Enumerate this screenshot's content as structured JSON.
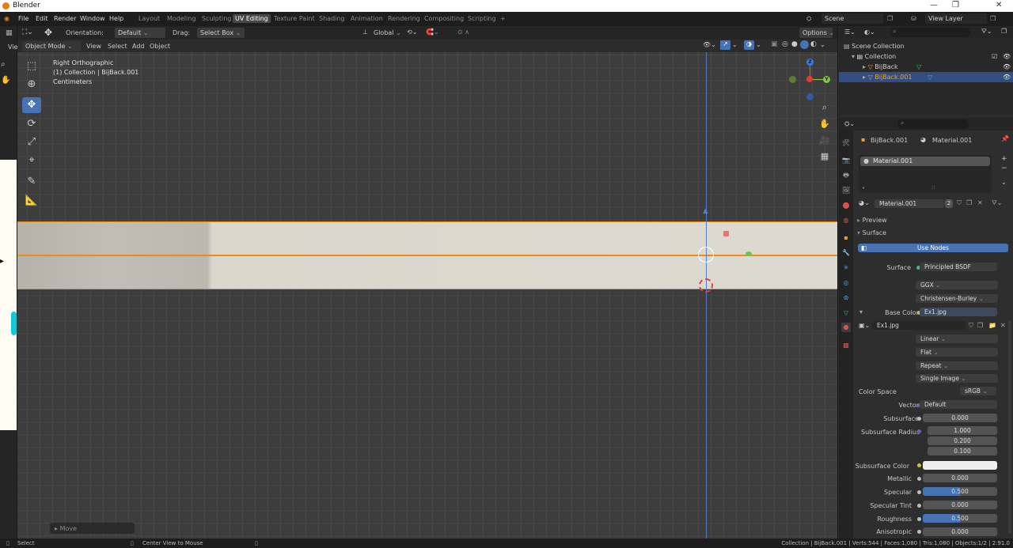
{
  "window": {
    "title": "Blender",
    "minimize": "—",
    "maximize": "❐",
    "close": "✕"
  },
  "menu": [
    "File",
    "Edit",
    "Render",
    "Window",
    "Help"
  ],
  "workspaces": [
    "Layout",
    "Modeling",
    "Sculpting",
    "UV Editing",
    "Texture Paint",
    "Shading",
    "Animation",
    "Rendering",
    "Compositing",
    "Scripting",
    "+"
  ],
  "active_workspace": "UV Editing",
  "scene": {
    "name": "Scene",
    "view_layer": "View Layer"
  },
  "left_strip": {
    "view_label": "Vie"
  },
  "header": {
    "orientation_label": "Orientation:",
    "orientation_value": "Default",
    "drag_label": "Drag:",
    "drag_value": "Select Box",
    "transform_orientation": "Global",
    "options": "Options"
  },
  "viewport_menu": {
    "mode": "Object Mode",
    "items": [
      "View",
      "Select",
      "Add",
      "Object"
    ]
  },
  "viewport_info": {
    "view": "Right Orthographic",
    "collection": "(1) Collection | BijBack.001",
    "units": "Centimeters"
  },
  "gizmo": {
    "z": "Z",
    "y": "Y"
  },
  "last_operation": "Move",
  "outliner": {
    "rows": [
      {
        "label": "Scene Collection"
      },
      {
        "label": "Collection"
      },
      {
        "label": "BijBack"
      },
      {
        "label": "BijBack.001"
      }
    ]
  },
  "properties": {
    "object_name": "BijBack.001",
    "material_name": "Material.001",
    "slot_name": "Material.001",
    "material_users": "2",
    "panels": {
      "preview": "Preview",
      "surface": "Surface"
    },
    "use_nodes": "Use Nodes",
    "surface_label": "Surface",
    "surface_value": "Principled BSDF",
    "distribution": "GGX",
    "subsurface_method": "Christensen-Burley",
    "base_color_label": "Base Color",
    "base_color_value": "Ex1.jpg",
    "image_name": "Ex1.jpg",
    "interpolation": "Linear",
    "projection": "Flat",
    "extension": "Repeat",
    "source": "Single Image",
    "color_space_label": "Color Space",
    "color_space_value": "sRGB",
    "vector_label": "Vector",
    "vector_value": "Default",
    "subsurface_label": "Subsurface",
    "subsurface_value": "0.000",
    "subsurface_radius_label": "Subsurface Radius",
    "subsurface_radius": [
      "1.000",
      "0.200",
      "0.100"
    ],
    "subsurface_color_label": "Subsurface Color",
    "metallic_label": "Metallic",
    "metallic_value": "0.000",
    "specular_label": "Specular",
    "specular_value": "0.500",
    "specular_fill": 0.5,
    "specular_tint_label": "Specular Tint",
    "specular_tint_value": "0.000",
    "roughness_label": "Roughness",
    "roughness_value": "0.500",
    "roughness_fill": 0.5,
    "anisotropic_label": "Anisotropic",
    "anisotropic_value": "0.000"
  },
  "statusbar": {
    "select": "Select",
    "center_view": "Center View to Mouse",
    "stats": "Collection | BijBack.001 | Verts:544 | Faces:1,080 | Tris:1,080 | Objects:1/2 | 2.91.0"
  },
  "colors": {
    "accent": "#4772b3",
    "selection": "#ec8b17",
    "z_axis": "#4f7ec7"
  }
}
